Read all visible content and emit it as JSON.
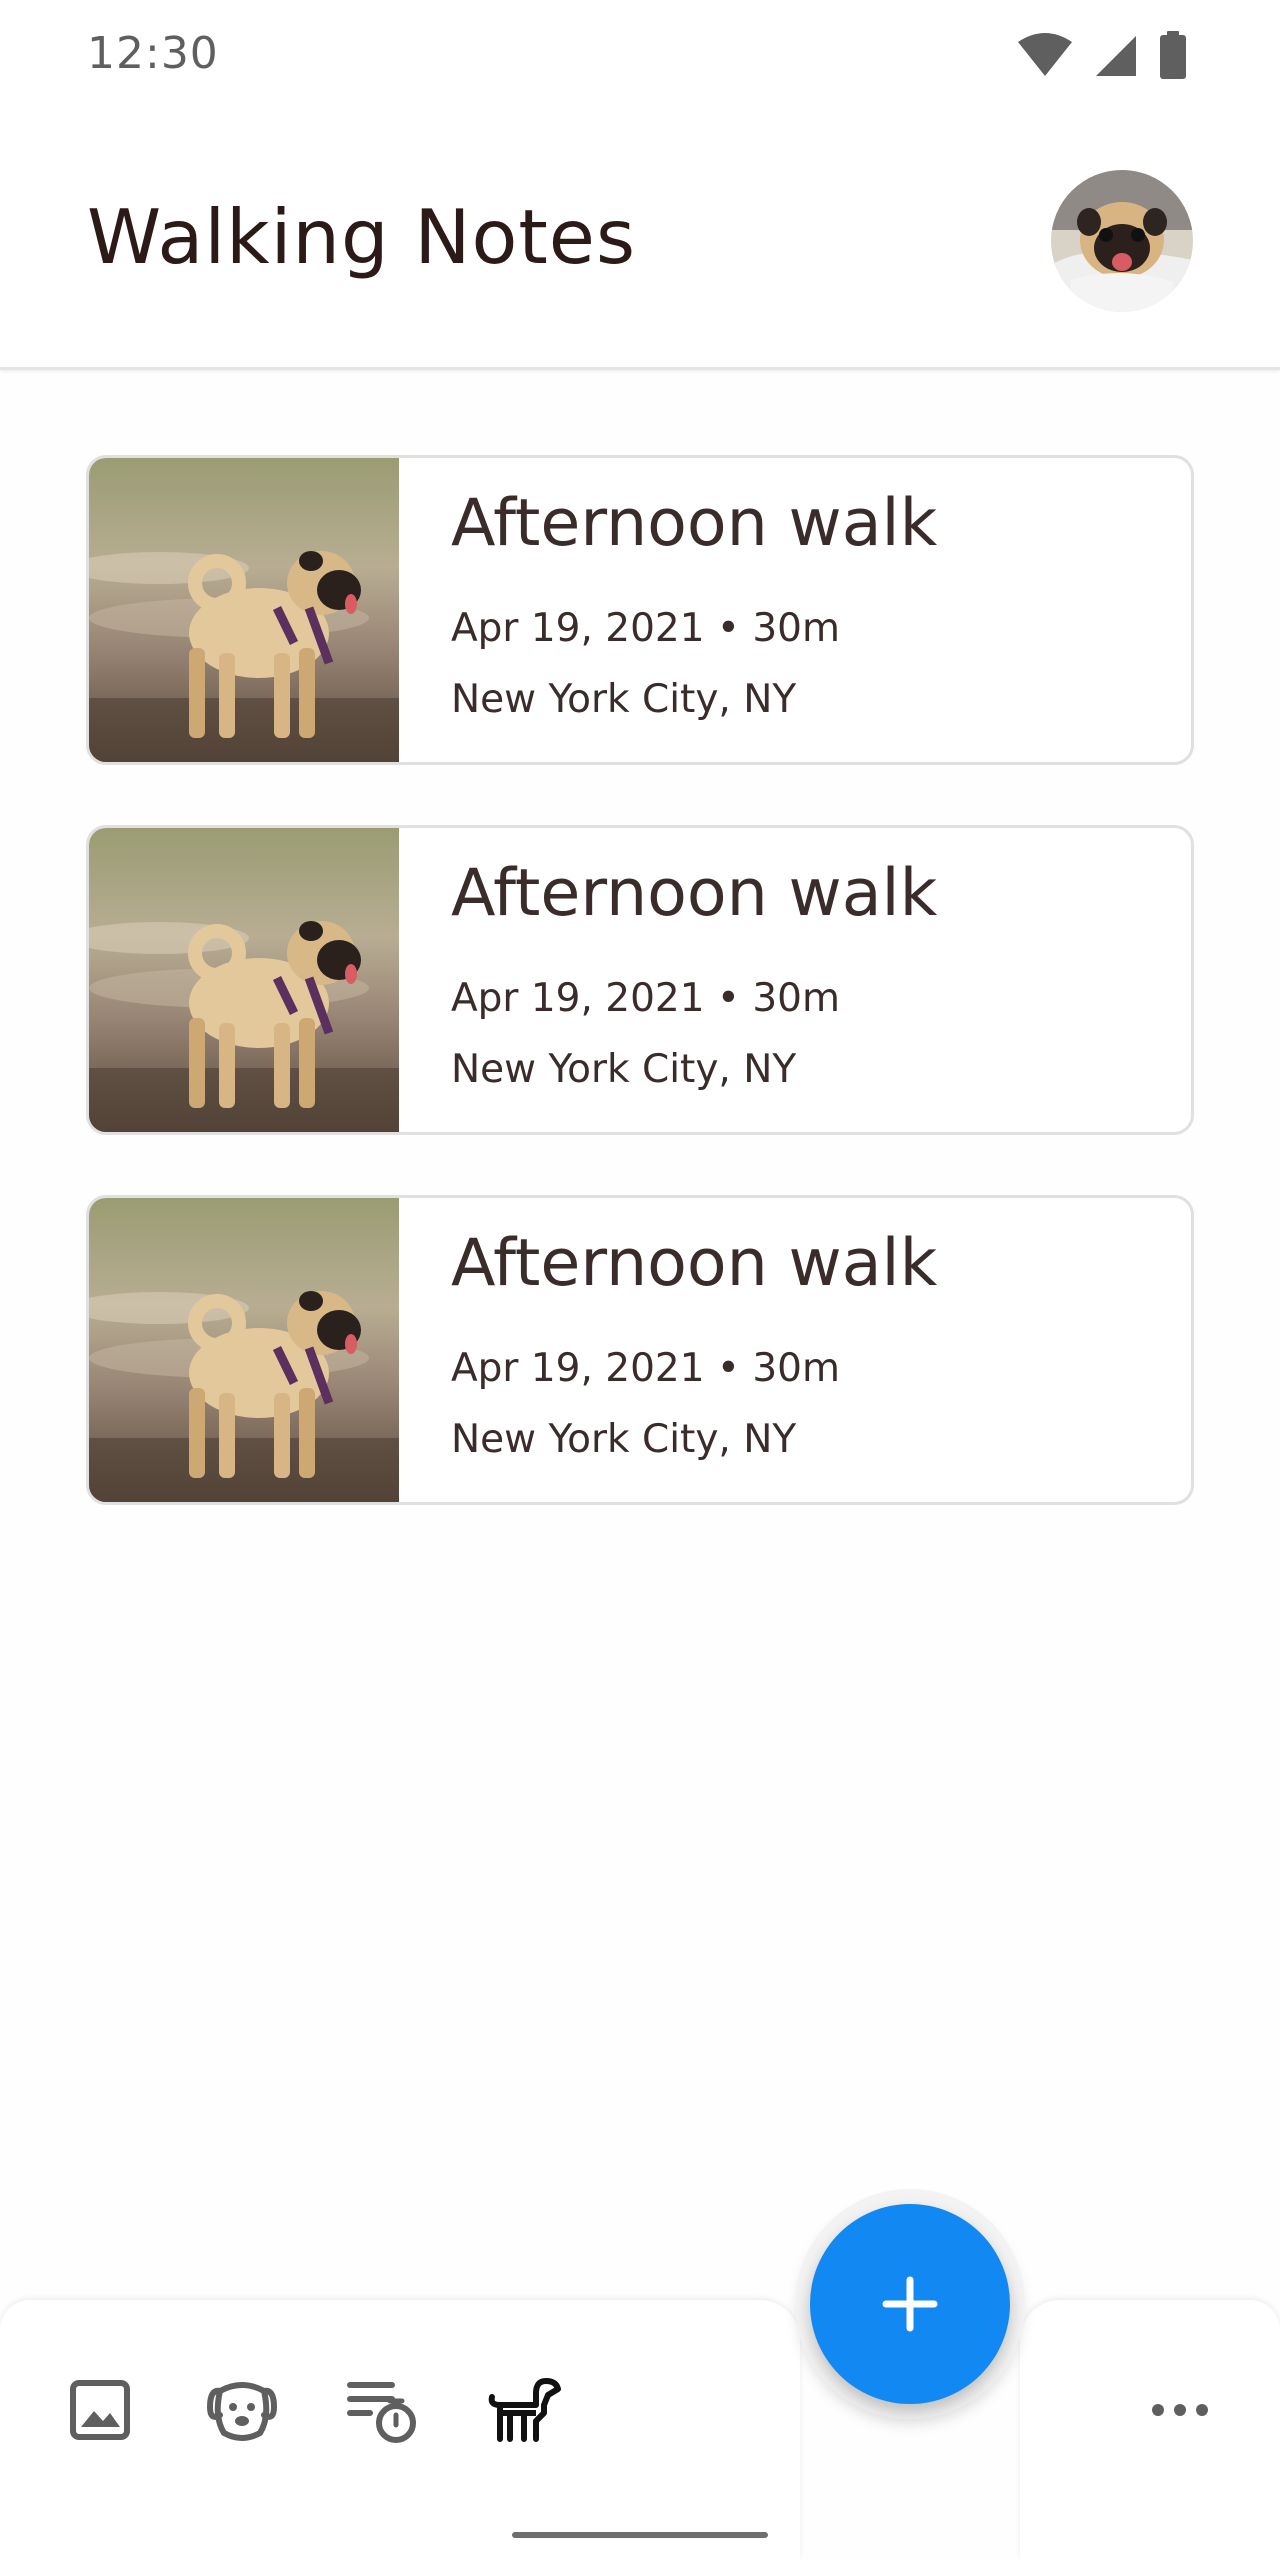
{
  "status_bar": {
    "time": "12:30",
    "icons": [
      "wifi-icon",
      "cell-signal-icon",
      "battery-icon"
    ]
  },
  "app_bar": {
    "title": "Walking Notes",
    "avatar": "pug-profile-avatar"
  },
  "walks": [
    {
      "title": "Afternoon walk",
      "meta": "Apr 19, 2021 • 30m",
      "location": "New York City, NY",
      "thumbnail": "pug-photo"
    },
    {
      "title": "Afternoon walk",
      "meta": "Apr 19, 2021 • 30m",
      "location": "New York City, NY",
      "thumbnail": "pug-photo"
    },
    {
      "title": "Afternoon walk",
      "meta": "Apr 19, 2021 • 30m",
      "location": "New York City, NY",
      "thumbnail": "pug-photo"
    }
  ],
  "bottom_nav": {
    "items": [
      {
        "icon": "image-icon",
        "active": false
      },
      {
        "icon": "dog-face-icon",
        "active": false
      },
      {
        "icon": "list-timer-icon",
        "active": false
      },
      {
        "icon": "dog-walk-icon",
        "active": true
      }
    ],
    "fab_icon": "plus-icon",
    "overflow_icon": "more-horizontal-icon"
  },
  "colors": {
    "accent": "#1289f2",
    "title_text": "#2b1a18",
    "body_text": "#3a2c2a",
    "card_border": "#e0e0e0",
    "icon_inactive": "#5f5f5f",
    "icon_active": "#111111"
  }
}
